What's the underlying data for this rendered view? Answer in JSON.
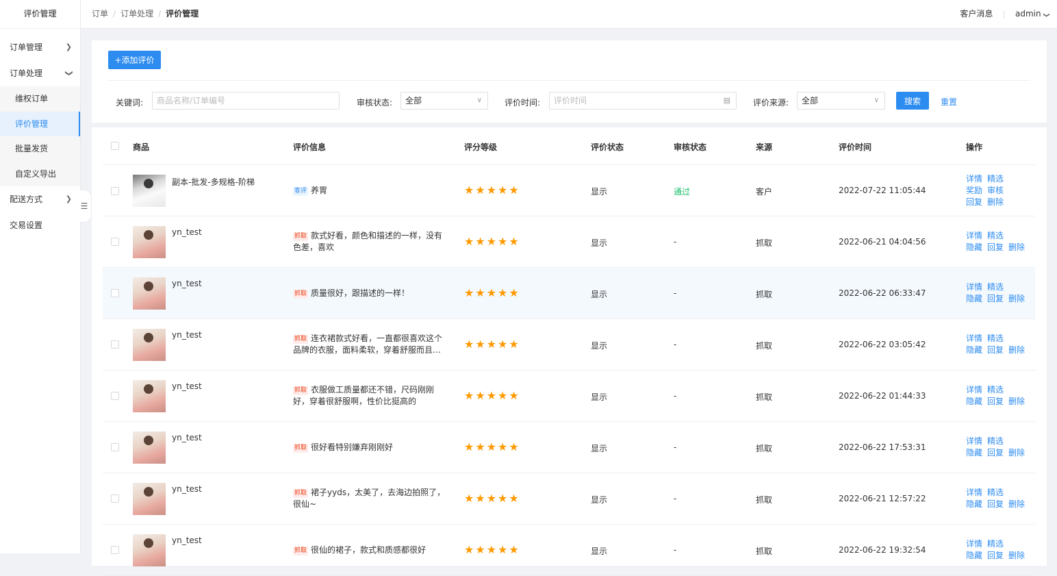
{
  "sidebar": {
    "title": "评价管理",
    "menu": [
      {
        "label": "订单管理"
      },
      {
        "label": "订单处理"
      },
      {
        "label": "配送方式"
      },
      {
        "label": "交易设置"
      }
    ],
    "submenu": [
      {
        "label": "维权订单"
      },
      {
        "label": "评价管理"
      },
      {
        "label": "批量发货"
      },
      {
        "label": "自定义导出"
      }
    ]
  },
  "header": {
    "breadcrumb": [
      "订单",
      "订单处理",
      "评价管理"
    ],
    "messages": "客户消息",
    "user": "admin"
  },
  "filters": {
    "add_button": "+添加评价",
    "keyword_label": "关键词:",
    "keyword_placeholder": "商品名称/订单编号",
    "audit_label": "审核状态:",
    "audit_value": "全部",
    "time_label": "评价时间:",
    "time_placeholder": "评价时间",
    "source_label": "评价来源:",
    "source_value": "全部",
    "search_button": "搜索",
    "reset_link": "重置"
  },
  "table": {
    "columns": [
      "商品",
      "评价信息",
      "评分等级",
      "评价状态",
      "审核状态",
      "来源",
      "评价时间",
      "操作"
    ],
    "rows": [
      {
        "product": "副本-批发-多规格-阶梯",
        "tag": "客评",
        "review": "养胃",
        "stars": 5,
        "status": "显示",
        "audit": "通过",
        "source": "客户",
        "time": "2022-07-22 11:05:44",
        "ops": [
          [
            "详情",
            "精选"
          ],
          [
            "奖励",
            "审核"
          ],
          [
            "回复",
            "删除"
          ]
        ]
      },
      {
        "product": "yn_test",
        "tag": "抓取",
        "review": "款式好看，颜色和描述的一样，没有色差，喜欢",
        "stars": 5,
        "status": "显示",
        "audit": "-",
        "source": "抓取",
        "time": "2022-06-21 04:04:56",
        "ops": [
          [
            "详情",
            "精选"
          ],
          [
            "隐藏",
            "回复",
            "删除"
          ]
        ]
      },
      {
        "product": "yn_test",
        "tag": "抓取",
        "review": "质量很好，跟描述的一样！",
        "stars": 5,
        "status": "显示",
        "audit": "-",
        "source": "抓取",
        "time": "2022-06-22 06:33:47",
        "ops": [
          [
            "详情",
            "精选"
          ],
          [
            "隐藏",
            "回复",
            "删除"
          ]
        ]
      },
      {
        "product": "yn_test",
        "tag": "抓取",
        "review": "连衣裙款式好看，一直都很喜欢这个品牌的衣服，面料柔软，穿着舒服而且十分显瘦",
        "stars": 5,
        "status": "显示",
        "audit": "-",
        "source": "抓取",
        "time": "2022-06-22 03:05:42",
        "ops": [
          [
            "详情",
            "精选"
          ],
          [
            "隐藏",
            "回复",
            "删除"
          ]
        ]
      },
      {
        "product": "yn_test",
        "tag": "抓取",
        "review": "衣服做工质量都还不错，尺码刚刚好，穿着很舒服啊，性价比挺高的",
        "stars": 5,
        "status": "显示",
        "audit": "-",
        "source": "抓取",
        "time": "2022-06-22 01:44:33",
        "ops": [
          [
            "详情",
            "精选"
          ],
          [
            "隐藏",
            "回复",
            "删除"
          ]
        ]
      },
      {
        "product": "yn_test",
        "tag": "抓取",
        "review": "很好看特别嫌弃刚刚好",
        "stars": 5,
        "status": "显示",
        "audit": "-",
        "source": "抓取",
        "time": "2022-06-22 17:53:31",
        "ops": [
          [
            "详情",
            "精选"
          ],
          [
            "隐藏",
            "回复",
            "删除"
          ]
        ]
      },
      {
        "product": "yn_test",
        "tag": "抓取",
        "review": "裙子yyds，太美了，去海边拍照了，很仙~",
        "stars": 5,
        "status": "显示",
        "audit": "-",
        "source": "抓取",
        "time": "2022-06-21 12:57:22",
        "ops": [
          [
            "详情",
            "精选"
          ],
          [
            "隐藏",
            "回复",
            "删除"
          ]
        ]
      },
      {
        "product": "yn_test",
        "tag": "抓取",
        "review": "很仙的裙子，款式和质感都很好",
        "stars": 5,
        "status": "显示",
        "audit": "-",
        "source": "抓取",
        "time": "2022-06-22 19:32:54",
        "ops": [
          [
            "详情",
            "精选"
          ],
          [
            "隐藏",
            "回复",
            "删除"
          ]
        ]
      }
    ]
  }
}
